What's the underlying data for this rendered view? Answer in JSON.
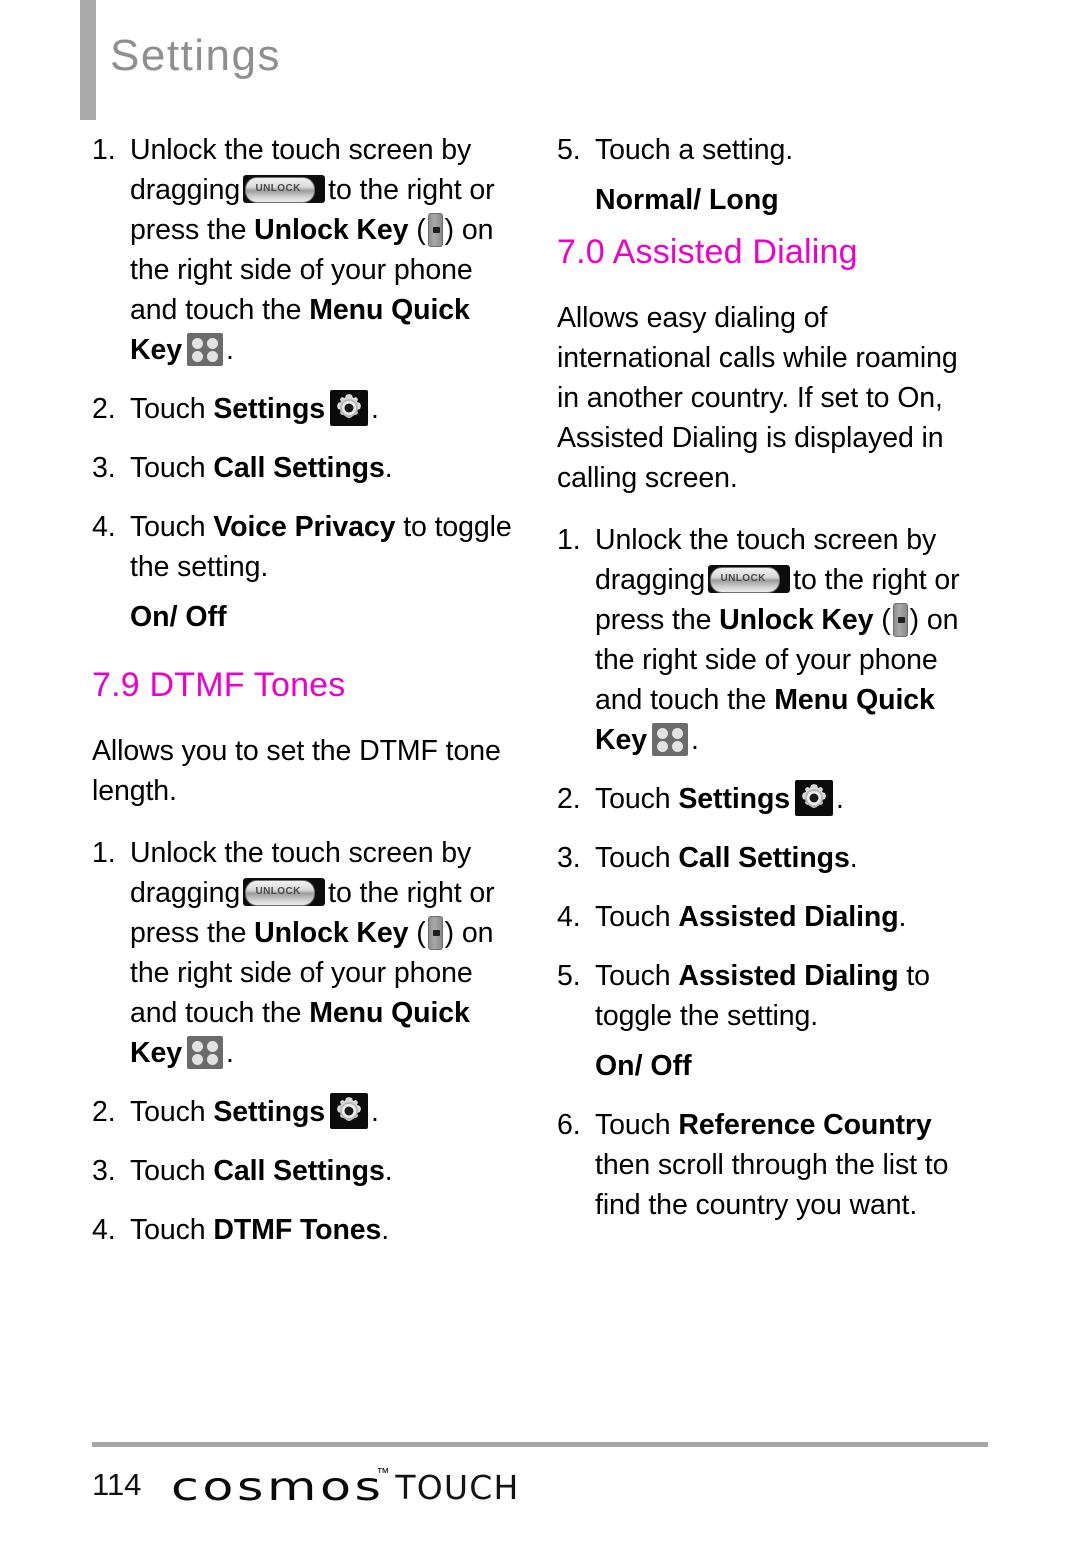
{
  "header": {
    "title": "Settings"
  },
  "colors": {
    "heading_magenta": "#EE00CC",
    "header_gray": "#8F8F8F",
    "rule_gray": "#A6A6A6"
  },
  "icons": {
    "unlock_slider_label": "UNLOCK",
    "unlock_key": "unlock-key-icon",
    "menu_quick_key": "menu-quick-key-icon",
    "settings_gear": "settings-gear-icon"
  },
  "unlock_step": {
    "num": "1.",
    "t1": "Unlock the touch screen by dragging",
    "t2": "to the right or press the",
    "b1": "Unlock Key",
    "t3": "(",
    "t4": ") on the right side of your phone and touch the",
    "b2": "Menu Quick Key",
    "t5": "."
  },
  "left_column": {
    "voice_privacy_steps": {
      "step2": {
        "num": "2.",
        "pre": "Touch",
        "bold": "Settings",
        "post": "."
      },
      "step3": {
        "num": "3.",
        "pre": "Touch",
        "bold": "Call Settings",
        "post": "."
      },
      "step4": {
        "num": "4.",
        "pre": "Touch",
        "bold": "Voice Privacy",
        "post": "to toggle the setting."
      },
      "value": "On/ Off"
    },
    "dtmf": {
      "heading": "7.9 DTMF Tones",
      "description": "Allows you to set the DTMF tone length.",
      "step2": {
        "num": "2.",
        "pre": "Touch",
        "bold": "Settings",
        "post": "."
      },
      "step3": {
        "num": "3.",
        "pre": "Touch",
        "bold": "Call Settings",
        "post": "."
      },
      "step4": {
        "num": "4.",
        "pre": "Touch",
        "bold": "DTMF Tones",
        "post": "."
      }
    }
  },
  "right_column": {
    "dtmf_tail": {
      "step5": {
        "num": "5.",
        "text": "Touch a setting."
      },
      "value": "Normal/ Long"
    },
    "assisted_dialing": {
      "heading": "7.0 Assisted Dialing",
      "description": "Allows easy dialing of international calls while roaming in another country. If set to On, Assisted Dialing is displayed in calling screen.",
      "step2": {
        "num": "2.",
        "pre": "Touch",
        "bold": "Settings",
        "post": "."
      },
      "step3": {
        "num": "3.",
        "pre": "Touch",
        "bold": "Call Settings",
        "post": "."
      },
      "step4": {
        "num": "4.",
        "pre": "Touch",
        "bold": "Assisted Dialing",
        "post": "."
      },
      "step5": {
        "num": "5.",
        "pre": "Touch",
        "bold": "Assisted Dialing",
        "post": "to toggle the setting."
      },
      "value": "On/ Off",
      "step6": {
        "num": "6.",
        "pre": "Touch",
        "bold": "Reference Country",
        "post": "then scroll through the list to find the country you want."
      }
    }
  },
  "footer": {
    "page_number": "114",
    "brand": "cosmos",
    "trademark": "™",
    "brand_sub": "TOUCH"
  }
}
